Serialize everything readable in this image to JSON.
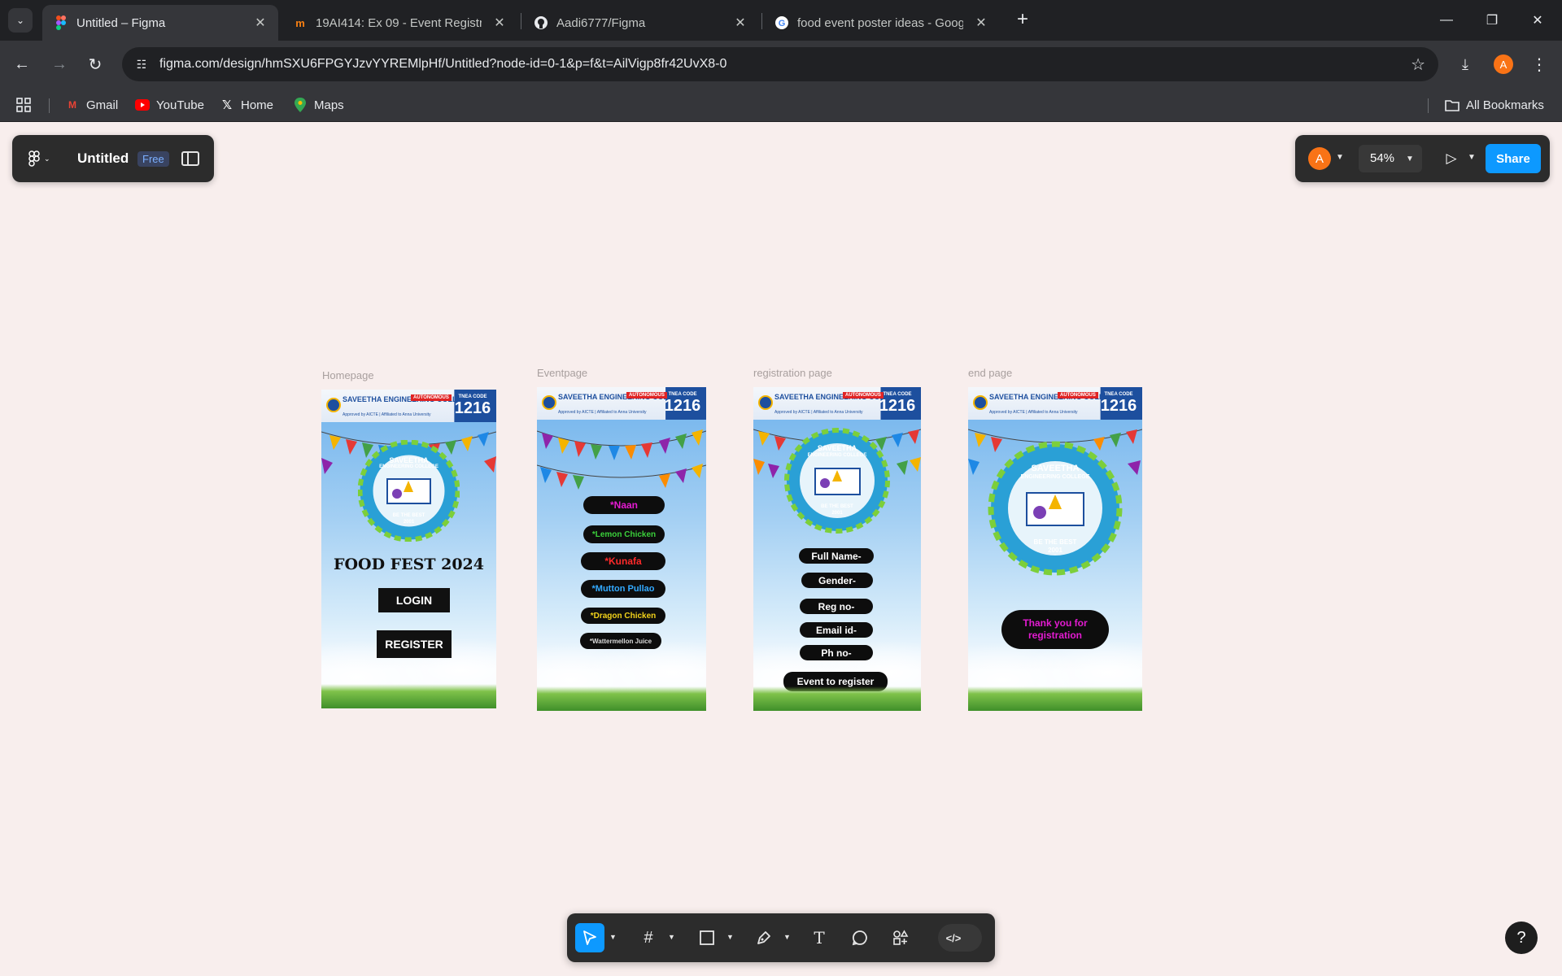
{
  "browser": {
    "tabs": [
      {
        "title": "Untitled – Figma",
        "icon": "figma-icon",
        "active": true
      },
      {
        "title": "19AI414: Ex 09 - Event Registrat",
        "icon": "moodle-icon",
        "active": false
      },
      {
        "title": "Aadi6777/Figma",
        "icon": "github-icon",
        "active": false
      },
      {
        "title": "food event poster ideas - Goog",
        "icon": "google-icon",
        "active": false
      }
    ],
    "url": "figma.com/design/hmSXU6FPGYJzvYYREMlpHf/Untitled?node-id=0-1&p=f&t=AilVigp8fr42UvX8-0",
    "profile_initial": "A",
    "bookmarks": [
      {
        "label": "Gmail",
        "icon": "gmail-icon"
      },
      {
        "label": "YouTube",
        "icon": "youtube-icon"
      },
      {
        "label": "Home",
        "icon": "x-icon"
      },
      {
        "label": "Maps",
        "icon": "maps-icon"
      }
    ],
    "all_bookmarks": "All Bookmarks"
  },
  "figma": {
    "file_name": "Untitled",
    "plan_badge": "Free",
    "user_initial": "A",
    "zoom": "54%",
    "share_label": "Share",
    "colors": {
      "accent": "#0d99ff",
      "canvas": "#f8eeed",
      "panel": "#2c2c2c",
      "avatar": "#f97316"
    }
  },
  "frames": [
    {
      "label": "Homepage",
      "college": "SAVEETHA ENGINEERING COLLEGE",
      "autonomous": "AUTONOMOUS",
      "tnea_label": "TNEA CODE",
      "tnea_code": "1216",
      "approved": "Approved by AICTE | Affiliated to Anna University",
      "seal_top": "SAVEETHA",
      "seal_sub": "ENGINEERING COLLEGE",
      "seal_motto": "BE THE BEST",
      "seal_year": "2001",
      "title": "FOOD FEST 2024",
      "buttons": [
        "LOGIN",
        "REGISTER"
      ]
    },
    {
      "label": "Eventpage",
      "items": [
        {
          "text": "*Naan",
          "color": "#e31bd1"
        },
        {
          "text": "*Lemon Chicken",
          "color": "#3bd13b"
        },
        {
          "text": "*Kunafa",
          "color": "#ff2a2a"
        },
        {
          "text": "*Mutton Pullao",
          "color": "#33aaff"
        },
        {
          "text": "*Dragon Chicken",
          "color": "#f2d21a"
        },
        {
          "text": "*Wattermellon Juice",
          "color": "#d9d9d9"
        }
      ]
    },
    {
      "label": "registration page",
      "fields": [
        "Full Name-",
        "Gender-",
        "Reg no-",
        "Email id-",
        "Ph no-",
        "Event to register"
      ]
    },
    {
      "label": "end page",
      "message": "Thank you for registration"
    }
  ],
  "bottom_toolbar": {
    "tools": [
      "move-tool",
      "frame-tool",
      "shape-tool",
      "pen-tool",
      "text-tool",
      "comment-tool",
      "actions-tool"
    ],
    "dev_mode_label": "</>"
  },
  "help_label": "?"
}
